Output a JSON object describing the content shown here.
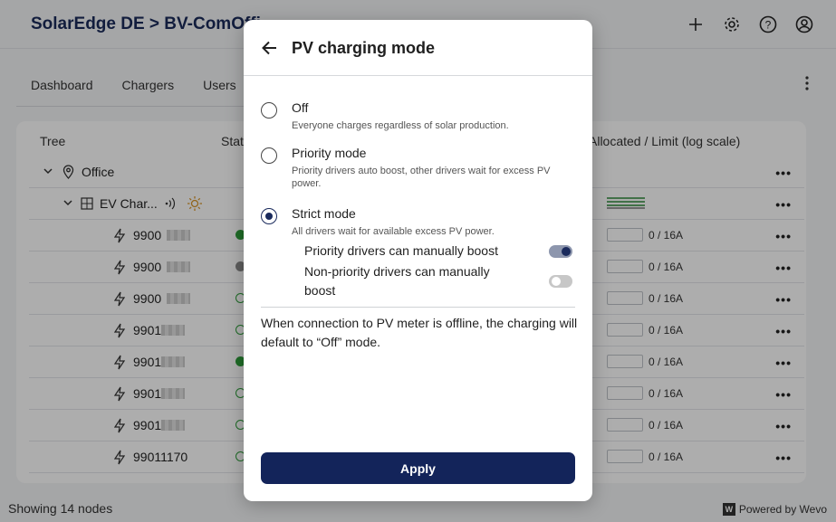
{
  "app": {
    "title": "SolarEdge DE > BV-ComOffi",
    "icons": [
      "plus-icon",
      "gear-icon",
      "help-icon",
      "account-icon"
    ]
  },
  "tabs": [
    {
      "label": "Dashboard"
    },
    {
      "label": "Chargers"
    },
    {
      "label": "Users"
    }
  ],
  "table": {
    "columns": {
      "tree": "Tree",
      "status": "Stat",
      "allocated": "Allocated / Limit (log scale)"
    },
    "rows": [
      {
        "label": "Office",
        "dots": "•••"
      },
      {
        "label": "EV Char...",
        "dots": "•••"
      },
      {
        "label": "9900",
        "status_color": "#2e9e3a",
        "limit": "0 / 16A",
        "dots": "•••"
      },
      {
        "label": "9900",
        "status_color": "#8a8a8a",
        "limit": "0 / 16A",
        "dots": "•••"
      },
      {
        "label": "9900",
        "status_color": "ring",
        "limit": "0 / 16A",
        "dots": "•••"
      },
      {
        "label": "9901",
        "status_color": "ring",
        "limit": "0 / 16A",
        "dots": "•••"
      },
      {
        "label": "9901",
        "status_color": "#2e9e3a",
        "limit": "0 / 16A",
        "dots": "•••"
      },
      {
        "label": "9901",
        "status_color": "ring",
        "limit": "0 / 16A",
        "dots": "•••"
      },
      {
        "label": "9901",
        "status_color": "ring",
        "limit": "0 / 16A",
        "dots": "•••"
      },
      {
        "label": "99011170",
        "status_color": "ring",
        "limit": "0 / 16A",
        "dots": "•••"
      }
    ]
  },
  "footer": {
    "nodes": "Showing 14 nodes",
    "powered_by": "Powered by Wevo",
    "logo_letter": "W"
  },
  "modal": {
    "title": "PV charging mode",
    "options": [
      {
        "title": "Off",
        "desc": "Everyone charges regardless of solar production.",
        "selected": false
      },
      {
        "title": "Priority mode",
        "desc": "Priority drivers auto boost, other drivers wait for excess PV power.",
        "selected": false
      },
      {
        "title": "Strict mode",
        "desc": "All drivers wait for available excess PV power.",
        "selected": true
      }
    ],
    "sub_options": [
      {
        "label": "Priority drivers can manually boost",
        "enabled": true
      },
      {
        "label": "Non-priority drivers can manually boost",
        "enabled": false
      }
    ],
    "note": "When connection to PV meter is offline, the charging will default to “Off” mode.",
    "apply_label": "Apply"
  }
}
